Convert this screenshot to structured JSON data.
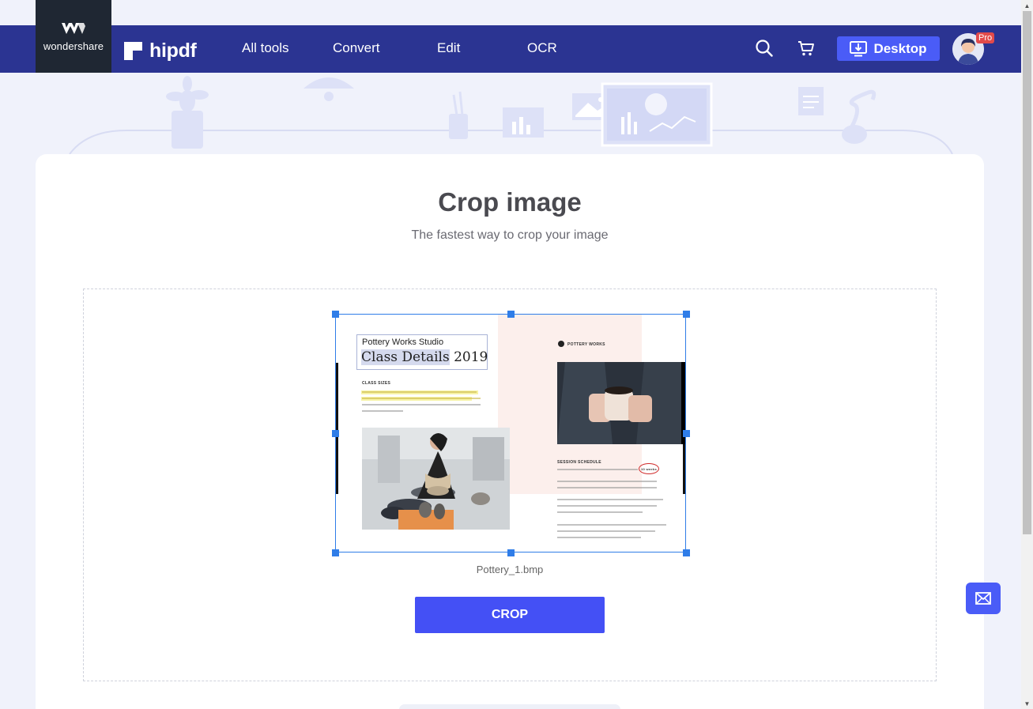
{
  "brand": {
    "company": "wondershare",
    "product": "hipdf"
  },
  "nav": {
    "items": [
      "All tools",
      "Convert",
      "Edit",
      "OCR"
    ],
    "desktop_label": "Desktop",
    "pro_badge": "Pro"
  },
  "page": {
    "title": "Crop image",
    "subtitle": "The fastest way to crop your image"
  },
  "file": {
    "name": "Pottery_1.bmp"
  },
  "doc_preview": {
    "studio": "Pottery Works Studio",
    "heading_highlight": "Class Details",
    "heading_year": "2019",
    "class_sizes": "CLASS SIZES",
    "brand_small": "POTTERY WORKS",
    "session_schedule": "SESSION SCHEDULE",
    "weeks": "10 weeks"
  },
  "actions": {
    "crop_label": "CROP"
  },
  "icons": {
    "search": "search-icon",
    "cart": "cart-icon",
    "download": "download-icon",
    "mail": "mail-icon"
  },
  "colors": {
    "nav_bg": "#2b3492",
    "accent": "#4a5cf7",
    "crop_button": "#4450f5",
    "selection": "#2f7de8"
  }
}
